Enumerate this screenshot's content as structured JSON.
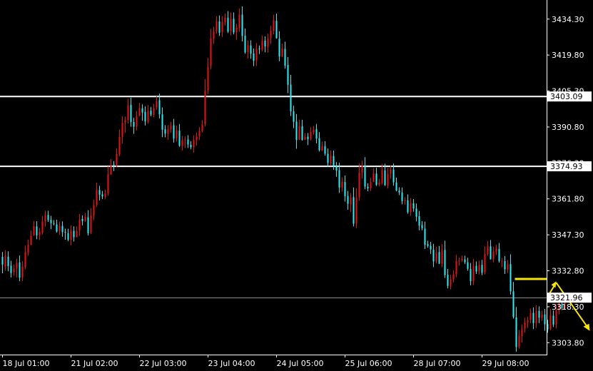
{
  "chart_data": {
    "type": "candlestick",
    "title": "",
    "colors": {
      "background": "#000000",
      "bull": "#e0161b",
      "bear": "#36e8ef",
      "axis": "#ffffff",
      "level_line": "#ffffff",
      "key_line": "#f5e60a",
      "projection_arrow": "#f5e60a",
      "bid_line": "#8a8a8a"
    },
    "y_axis": {
      "ticks": [
        "3434.30",
        "3419.80",
        "3405.30",
        "3390.80",
        "3376.30",
        "3361.80",
        "3347.30",
        "3332.80",
        "3318.30",
        "3303.80"
      ],
      "ylim": [
        3299.0,
        3442.0
      ]
    },
    "x_axis": {
      "labels": [
        "18 Jul 01:00",
        "21 Jul 02:00",
        "22 Jul 03:00",
        "23 Jul 04:00",
        "24 Jul 05:00",
        "25 Jul 06:00",
        "28 Jul 07:00",
        "29 Jul 08:00"
      ],
      "bars_between_labels": 24
    },
    "horizontal_levels": [
      {
        "name": "resistance-upper",
        "price": 3403.09,
        "label": "3403.09"
      },
      {
        "name": "resistance-lower",
        "price": 3374.93,
        "label": "3374.93"
      }
    ],
    "current_price": {
      "price": 3321.96,
      "label": "3321.96"
    },
    "key_level": {
      "price": 3329.5,
      "from_bar": 180
    },
    "projection": {
      "start_bar": 194,
      "start_price": 3328.0,
      "end_bar": 205,
      "end_price": 3310.0
    },
    "candles": [
      [
        3338.4,
        3335.3,
        3331.8
      ],
      [
        3334.5,
        3338.8,
        3332.8
      ],
      [
        3338.5,
        3334.7,
        3332.6
      ],
      [
        3334.9,
        3331.9,
        3330.1
      ],
      [
        3332.2,
        3333.7,
        3330.8
      ],
      [
        3333.8,
        3335.9,
        3330.1
      ],
      [
        3336.2,
        3330.0,
        3328.6
      ],
      [
        3330.1,
        3334.4,
        3328.6
      ],
      [
        3334.2,
        3340.2,
        3333.4
      ],
      [
        3340.0,
        3343.3,
        3338.9
      ],
      [
        3343.2,
        3346.9,
        3343.1
      ],
      [
        3347.1,
        3350.8,
        3346.9
      ],
      [
        3350.7,
        3347.1,
        3345.5
      ],
      [
        3347.2,
        3348.5,
        3345.2
      ],
      [
        3348.1,
        3352.6,
        3347.4
      ],
      [
        3352.7,
        3355.2,
        3350.6
      ],
      [
        3355.3,
        3353.3,
        3352.5
      ],
      [
        3353.4,
        3352.0,
        3349.6
      ],
      [
        3352.0,
        3351.8,
        3351.1
      ],
      [
        3351.5,
        3348.6,
        3348.2
      ],
      [
        3348.7,
        3350.9,
        3347.3
      ],
      [
        3350.9,
        3348.4,
        3346.5
      ],
      [
        3348.5,
        3348.2,
        3345.3
      ],
      [
        3347.9,
        3345.3,
        3344.7
      ],
      [
        3345.3,
        3349.0,
        3343.1
      ],
      [
        3348.9,
        3346.3,
        3344.6
      ],
      [
        3346.3,
        3348.9,
        3346.3
      ],
      [
        3349.1,
        3353.4,
        3346.9
      ],
      [
        3353.7,
        3352.8,
        3351.1
      ],
      [
        3352.8,
        3354.5,
        3352.5
      ],
      [
        3354.4,
        3347.9,
        3347.0
      ],
      [
        3348.1,
        3355.1,
        3347.6
      ],
      [
        3355.0,
        3359.3,
        3353.2
      ],
      [
        3359.3,
        3365.6,
        3358.6
      ],
      [
        3365.4,
        3363.5,
        3361.2
      ],
      [
        3363.6,
        3362.8,
        3361.7
      ],
      [
        3362.6,
        3364.0,
        3361.7
      ],
      [
        3364.1,
        3371.8,
        3363.1
      ],
      [
        3371.6,
        3375.6,
        3371.5
      ],
      [
        3375.7,
        3375.3,
        3373.0
      ],
      [
        3375.2,
        3379.9,
        3374.6
      ],
      [
        3379.7,
        3386.8,
        3379.0
      ],
      [
        3386.8,
        3392.5,
        3384.1
      ],
      [
        3392.5,
        3393.5,
        3388.5
      ],
      [
        3393.6,
        3399.5,
        3392.2
      ],
      [
        3399.7,
        3392.8,
        3390.9
      ],
      [
        3392.8,
        3390.9,
        3388.0
      ],
      [
        3390.9,
        3395.0,
        3389.4
      ],
      [
        3395.3,
        3398.5,
        3395.1
      ],
      [
        3398.3,
        3396.6,
        3393.3
      ],
      [
        3396.9,
        3393.0,
        3391.4
      ],
      [
        3392.7,
        3397.3,
        3392.1
      ],
      [
        3397.3,
        3395.8,
        3395.1
      ],
      [
        3395.7,
        3398.3,
        3394.7
      ],
      [
        3398.6,
        3401.3,
        3397.8
      ],
      [
        3401.6,
        3395.9,
        3394.2
      ],
      [
        3395.9,
        3389.7,
        3386.7
      ],
      [
        3389.9,
        3388.1,
        3386.6
      ],
      [
        3388.0,
        3389.9,
        3385.6
      ],
      [
        3389.8,
        3391.3,
        3388.5
      ],
      [
        3391.5,
        3386.1,
        3384.5
      ],
      [
        3386.3,
        3389.4,
        3384.9
      ],
      [
        3389.3,
        3383.2,
        3382.8
      ],
      [
        3383.1,
        3385.4,
        3381.3
      ],
      [
        3385.3,
        3385.7,
        3382.3
      ],
      [
        3385.8,
        3383.7,
        3382.3
      ],
      [
        3383.6,
        3382.6,
        3381.8
      ],
      [
        3382.6,
        3385.5,
        3380.4
      ],
      [
        3385.4,
        3387.0,
        3383.3
      ],
      [
        3387.1,
        3389.1,
        3385.5
      ],
      [
        3389.1,
        3391.7,
        3388.6
      ],
      [
        3391.9,
        3405.5,
        3391.0
      ],
      [
        3405.5,
        3415.1,
        3404.1
      ],
      [
        3415.4,
        3426.4,
        3414.1
      ],
      [
        3426.4,
        3429.3,
        3424.3
      ],
      [
        3429.4,
        3433.3,
        3428.4
      ],
      [
        3433.4,
        3428.8,
        3427.5
      ],
      [
        3429.0,
        3433.2,
        3427.1
      ],
      [
        3432.9,
        3434.9,
        3431.8
      ],
      [
        3434.9,
        3429.2,
        3428.7
      ],
      [
        3429.4,
        3434.5,
        3427.8
      ],
      [
        3434.4,
        3428.9,
        3428.1
      ],
      [
        3429.0,
        3430.8,
        3426.0
      ],
      [
        3430.8,
        3436.1,
        3429.2
      ],
      [
        3436.1,
        3427.5,
        3425.3
      ],
      [
        3427.6,
        3420.9,
        3420.3
      ],
      [
        3421.0,
        3423.8,
        3418.4
      ],
      [
        3423.7,
        3420.3,
        3418.3
      ],
      [
        3420.5,
        3417.5,
        3415.3
      ],
      [
        3417.7,
        3422.3,
        3415.4
      ],
      [
        3422.4,
        3422.1,
        3420.2
      ],
      [
        3422.0,
        3425.6,
        3421.2
      ],
      [
        3425.6,
        3423.3,
        3420.9
      ],
      [
        3423.1,
        3426.4,
        3420.7
      ],
      [
        3426.6,
        3429.6,
        3424.3
      ],
      [
        3429.5,
        3433.8,
        3428.1
      ],
      [
        3433.6,
        3426.6,
        3426.4
      ],
      [
        3426.4,
        3419.2,
        3417.3
      ],
      [
        3419.2,
        3422.4,
        3418.9
      ],
      [
        3422.3,
        3415.5,
        3414.3
      ],
      [
        3415.8,
        3407.8,
        3404.4
      ],
      [
        3407.9,
        3397.1,
        3395.2
      ],
      [
        3397.1,
        3392.9,
        3390.3
      ],
      [
        3393.0,
        3385.6,
        3382.0
      ],
      [
        3385.8,
        3391.2,
        3385.5
      ],
      [
        3391.1,
        3385.5,
        3385.3
      ],
      [
        3385.6,
        3386.8,
        3385.6
      ],
      [
        3386.9,
        3385.8,
        3383.5
      ],
      [
        3385.9,
        3388.8,
        3385.4
      ],
      [
        3388.6,
        3389.7,
        3387.7
      ],
      [
        3389.9,
        3386.1,
        3384.2
      ],
      [
        3386.3,
        3381.4,
        3380.9
      ],
      [
        3381.2,
        3383.2,
        3381.2
      ],
      [
        3383.1,
        3380.0,
        3379.2
      ],
      [
        3380.0,
        3376.3,
        3374.8
      ],
      [
        3376.1,
        3379.3,
        3375.1
      ],
      [
        3379.1,
        3375.2,
        3373.5
      ],
      [
        3375.0,
        3373.2,
        3370.7
      ],
      [
        3373.4,
        3366.4,
        3364.2
      ],
      [
        3366.3,
        3368.7,
        3364.7
      ],
      [
        3368.6,
        3362.9,
        3360.7
      ],
      [
        3363.0,
        3359.8,
        3357.4
      ],
      [
        3359.6,
        3362.3,
        3356.5
      ],
      [
        3362.5,
        3351.8,
        3350.7
      ],
      [
        3351.8,
        3362.3,
        3350.0
      ],
      [
        3362.4,
        3372.4,
        3361.1
      ],
      [
        3372.3,
        3375.3,
        3370.0
      ],
      [
        3375.3,
        3366.8,
        3365.7
      ],
      [
        3366.7,
        3366.0,
        3364.9
      ],
      [
        3366.0,
        3368.5,
        3365.0
      ],
      [
        3368.7,
        3372.1,
        3368.6
      ],
      [
        3372.0,
        3367.4,
        3367.0
      ],
      [
        3367.5,
        3368.4,
        3366.9
      ],
      [
        3368.2,
        3373.4,
        3367.6
      ],
      [
        3373.3,
        3367.3,
        3367.0
      ],
      [
        3367.2,
        3371.9,
        3366.0
      ],
      [
        3371.9,
        3373.7,
        3369.9
      ],
      [
        3373.6,
        3368.5,
        3367.1
      ],
      [
        3368.4,
        3365.2,
        3364.8
      ],
      [
        3365.1,
        3364.4,
        3363.3
      ],
      [
        3364.3,
        3360.9,
        3359.6
      ],
      [
        3360.9,
        3361.2,
        3359.5
      ],
      [
        3361.2,
        3356.4,
        3355.8
      ],
      [
        3356.5,
        3360.0,
        3355.0
      ],
      [
        3360.0,
        3357.9,
        3356.6
      ],
      [
        3357.9,
        3354.6,
        3352.7
      ],
      [
        3354.8,
        3351.1,
        3349.1
      ],
      [
        3351.3,
        3349.9,
        3349.1
      ],
      [
        3349.8,
        3343.3,
        3341.6
      ],
      [
        3343.5,
        3342.8,
        3342.1
      ],
      [
        3342.9,
        3341.4,
        3339.6
      ],
      [
        3341.3,
        3336.6,
        3334.3
      ],
      [
        3336.6,
        3340.3,
        3335.8
      ],
      [
        3340.4,
        3335.7,
        3335.5
      ],
      [
        3335.5,
        3341.0,
        3334.3
      ],
      [
        3341.2,
        3331.1,
        3329.9
      ],
      [
        3331.2,
        3326.7,
        3325.7
      ],
      [
        3326.6,
        3329.3,
        3325.3
      ],
      [
        3329.3,
        3331.3,
        3328.2
      ],
      [
        3331.3,
        3336.7,
        3330.2
      ],
      [
        3336.6,
        3336.9,
        3334.9
      ],
      [
        3337.0,
        3337.6,
        3336.4
      ],
      [
        3337.4,
        3336.3,
        3335.5
      ],
      [
        3336.2,
        3333.6,
        3332.8
      ],
      [
        3333.5,
        3328.6,
        3326.9
      ],
      [
        3328.5,
        3334.8,
        3327.0
      ],
      [
        3334.8,
        3332.5,
        3331.5
      ],
      [
        3332.6,
        3335.1,
        3331.3
      ],
      [
        3335.2,
        3332.0,
        3331.0
      ],
      [
        3332.1,
        3339.6,
        3331.3
      ],
      [
        3339.5,
        3342.7,
        3338.8
      ],
      [
        3342.7,
        3337.5,
        3337.3
      ],
      [
        3337.4,
        3340.6,
        3336.2
      ],
      [
        3340.5,
        3341.8,
        3339.1
      ],
      [
        3341.6,
        3336.7,
        3336.1
      ],
      [
        3336.8,
        3336.8,
        3334.3
      ],
      [
        3336.7,
        3333.4,
        3331.5
      ],
      [
        3333.3,
        3335.4,
        3331.9
      ],
      [
        3335.5,
        3324.5,
        3323.2
      ],
      [
        3324.5,
        3314.1,
        3313.5
      ],
      [
        3314.0,
        3302.0,
        3300.2
      ],
      [
        3302.1,
        3306.6,
        3301.4
      ],
      [
        3306.4,
        3309.2,
        3303.9
      ],
      [
        3309.4,
        3312.0,
        3307.9
      ],
      [
        3312.0,
        3312.8,
        3309.8
      ],
      [
        3313.0,
        3315.7,
        3311.7
      ],
      [
        3315.8,
        3311.7,
        3309.3
      ],
      [
        3311.6,
        3316.5,
        3309.7
      ],
      [
        3316.6,
        3313.9,
        3311.7
      ],
      [
        3313.8,
        3315.2,
        3312.6
      ],
      [
        3315.2,
        3311.2,
        3308.6
      ],
      [
        3311.3,
        3309.2,
        3307.8
      ],
      [
        3309.2,
        3314.8,
        3308.8
      ],
      [
        3314.7,
        3311.1,
        3310.1
      ],
      [
        3311.1,
        3316.7,
        3309.5
      ],
      [
        3316.7,
        3319.2,
        3315.2
      ],
      [
        3319.2,
        3317.8,
        3317.0
      ],
      [
        3317.7,
        3321.4,
        3317.1
      ],
      [
        3321.6,
        3322.0,
        3321.1
      ]
    ]
  }
}
